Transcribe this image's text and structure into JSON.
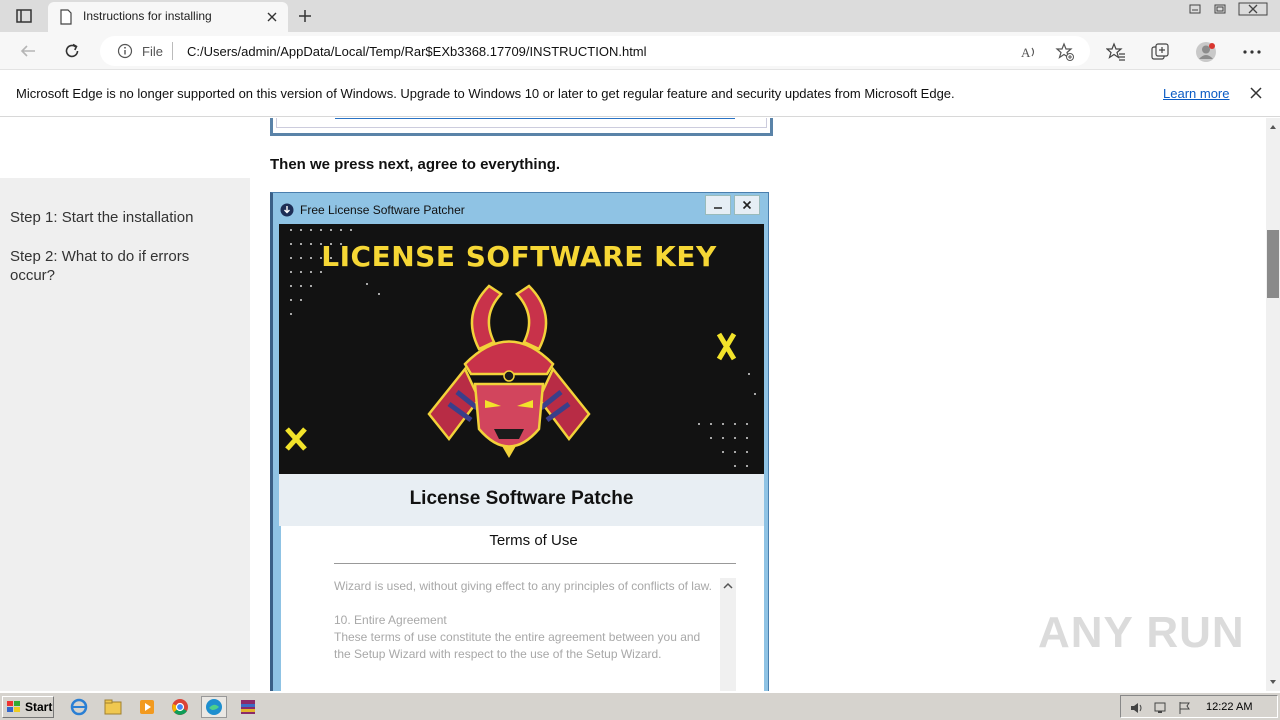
{
  "browser": {
    "tab_title": "Instructions for installing",
    "address": {
      "scheme_label": "File",
      "url": "C:/Users/admin/AppData/Local/Temp/Rar$EXb3368.17709/INSTRUCTION.html"
    },
    "infobar": {
      "message": "Microsoft Edge is no longer supported on this version of Windows. Upgrade to Windows 10 or later to get regular feature and security updates from Microsoft Edge.",
      "link": "Learn more"
    }
  },
  "page": {
    "sidebar": {
      "steps": [
        "Step 1: Start the installation",
        "Step 2: What to do if errors occur?"
      ]
    },
    "instruction": "Then we press next, agree to everything.",
    "installer": {
      "window_title": "Free License Software Patcher",
      "banner_title": "LICENSE SOFTWARE KEY",
      "panel_title": "License Software Patche",
      "section_title": "Terms of Use",
      "terms_lines": [
        "Wizard is used, without giving effect to any principles of conflicts of law.",
        "",
        "10. Entire Agreement",
        "These terms of use constitute the entire agreement between you and the Setup Wizard with respect to the use of the Setup Wizard."
      ]
    },
    "watermark": "ANY RUN"
  },
  "taskbar": {
    "start_label": "Start",
    "clock": "12:22 AM"
  },
  "colors": {
    "installer_frame": "#8fc3e4",
    "banner_bg": "#121212",
    "banner_text": "#f6d735",
    "samurai_red": "#c8324a",
    "accent_yellow": "#f2e32a"
  }
}
